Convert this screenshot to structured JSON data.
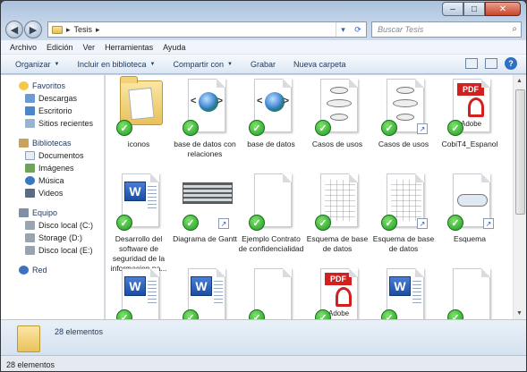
{
  "window": {
    "breadcrumb": [
      "Tesis"
    ],
    "search_placeholder": "Buscar Tesis"
  },
  "menu": [
    "Archivo",
    "Edición",
    "Ver",
    "Herramientas",
    "Ayuda"
  ],
  "commands": [
    {
      "label": "Organizar",
      "dropdown": true
    },
    {
      "label": "Incluir en biblioteca",
      "dropdown": true
    },
    {
      "label": "Compartir con",
      "dropdown": true
    },
    {
      "label": "Grabar",
      "dropdown": false
    },
    {
      "label": "Nueva carpeta",
      "dropdown": false
    }
  ],
  "nav": {
    "favoritos": {
      "label": "Favoritos",
      "items": [
        "Descargas",
        "Escritorio",
        "Sitios recientes"
      ]
    },
    "bibliotecas": {
      "label": "Bibliotecas",
      "items": [
        "Documentos",
        "Imágenes",
        "Música",
        "Videos"
      ]
    },
    "equipo": {
      "label": "Equipo",
      "items": [
        "Disco local (C:)",
        "Storage (D:)",
        "Disco local (E:)"
      ]
    },
    "red": {
      "label": "Red"
    }
  },
  "files": [
    {
      "name": "iconos",
      "kind": "folder",
      "shortcut": false
    },
    {
      "name": "base de datos con relaciones",
      "kind": "html",
      "shortcut": false
    },
    {
      "name": "base de datos",
      "kind": "html",
      "shortcut": false
    },
    {
      "name": "Casos de usos",
      "kind": "diagram",
      "shortcut": false
    },
    {
      "name": "Casos de usos",
      "kind": "diagram",
      "shortcut": true
    },
    {
      "name": "CobiT4_Espanol",
      "kind": "pdf",
      "shortcut": false
    },
    {
      "name": "Desarrollo del software de seguridad de la informacion pa...",
      "kind": "word",
      "shortcut": false
    },
    {
      "name": "Diagrama de Gantt",
      "kind": "gantt",
      "shortcut": true
    },
    {
      "name": "Ejemplo Contrato de confidencialidad",
      "kind": "blank",
      "shortcut": false
    },
    {
      "name": "Esquema de base de datos",
      "kind": "schema",
      "shortcut": false
    },
    {
      "name": "Esquema de base de datos",
      "kind": "schema",
      "shortcut": true
    },
    {
      "name": "Esquema",
      "kind": "esquema",
      "shortcut": true
    },
    {
      "name": "",
      "kind": "word",
      "shortcut": false
    },
    {
      "name": "",
      "kind": "word",
      "shortcut": false
    },
    {
      "name": "",
      "kind": "blank",
      "shortcut": false
    },
    {
      "name": "",
      "kind": "pdf",
      "shortcut": false
    },
    {
      "name": "",
      "kind": "word",
      "shortcut": false
    },
    {
      "name": "",
      "kind": "blank",
      "shortcut": false
    }
  ],
  "pdf_badge": "PDF",
  "adobe_text": "Adobe",
  "word_letter": "W",
  "details": {
    "count": "28 elementos"
  },
  "status": {
    "count": "28 elementos"
  }
}
